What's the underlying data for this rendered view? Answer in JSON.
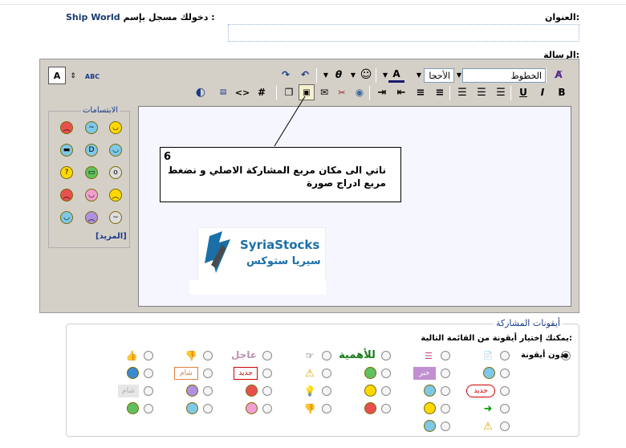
{
  "header": {
    "login_prefix": "دخولك مسجل بإسم :",
    "username": "Ship World",
    "title_label": "العنوان:",
    "message_label": "الرسالة:"
  },
  "toolbar": {
    "font_select": "الخطوط",
    "size_select": "الأحجا",
    "font_color_label": "A",
    "bold": "B",
    "italic": "I",
    "underline": "U",
    "hash": "#",
    "code": "<>",
    "spell": "ABC"
  },
  "smilies": {
    "title": "الابتسامات",
    "more": "[المزيد]"
  },
  "callout": {
    "number": "6",
    "text": "ناتي الى مكان مربع المشاركة الاصلي و نضغط مربع ادراج صورة"
  },
  "logo": {
    "en": "SyriaStocks",
    "ar": "سيريا ستوكس"
  },
  "post_icons": {
    "title": "أيقونات المشاركة",
    "hint": "يمكنك إختيار أيقونة من القائمة التالية:",
    "no_icon": "بدون أيقونة",
    "urgent": "عاجل",
    "important": "للأهمية",
    "news": "خبر",
    "new": "جديد",
    "new2": "جديد",
    "info": "شام",
    "mine": "شام"
  }
}
